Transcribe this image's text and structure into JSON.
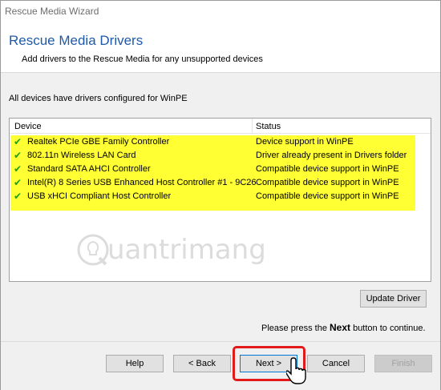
{
  "window": {
    "title": "Rescue Media Wizard"
  },
  "header": {
    "title": "Rescue Media Drivers",
    "subtitle": "Add drivers to the Rescue Media for any unsupported devices"
  },
  "info": "All devices have drivers configured for WinPE",
  "list": {
    "columns": {
      "device": "Device",
      "status": "Status"
    },
    "rows": [
      {
        "device": "Realtek PCIe GBE Family Controller",
        "status": "Device support in WinPE"
      },
      {
        "device": "802.11n Wireless LAN Card",
        "status": "Driver already present in Drivers folder"
      },
      {
        "device": "Standard SATA AHCI Controller",
        "status": "Compatible device support in WinPE"
      },
      {
        "device": "Intel(R) 8 Series USB Enhanced Host Controller #1 - 9C26",
        "status": "Compatible device support in WinPE"
      },
      {
        "device": "USB xHCI Compliant Host Controller",
        "status": "Compatible device support in WinPE"
      }
    ],
    "highlight_color": "#ffff33",
    "check_color": "#1aa01a"
  },
  "watermark": {
    "text": "uantrimang"
  },
  "buttons": {
    "update_driver": "Update Driver",
    "help": "Help",
    "back": "< Back",
    "next": "Next >",
    "cancel": "Cancel",
    "finish": "Finish"
  },
  "hint": {
    "prefix": "Please press the ",
    "keyword": "Next",
    "suffix": " button to continue."
  },
  "colors": {
    "title_blue": "#1e5aa8",
    "highlight_red": "#e31a1a"
  }
}
